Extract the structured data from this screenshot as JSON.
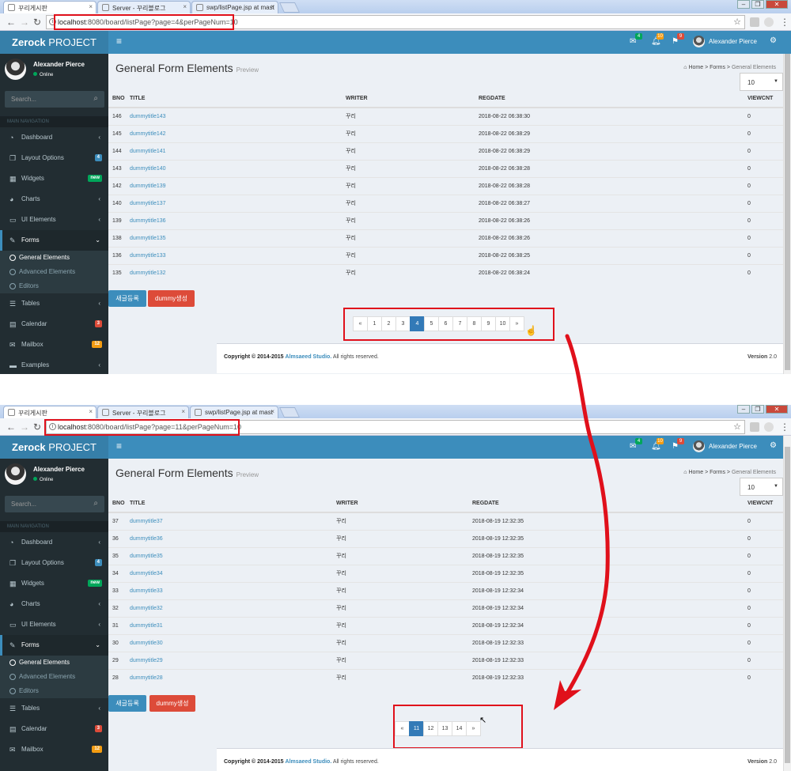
{
  "shots": [
    {
      "tabs": [
        "꾸리게시판",
        "Server - 꾸리블로그",
        "swp/listPage.jsp at mast"
      ],
      "url_host": "localhost",
      "url_rest": ":8080/board/listPage?page=4&perPageNum=10",
      "rows": [
        {
          "bno": "146",
          "title": "dummytitle143",
          "writer": "꾸리",
          "regdate": "2018-08-22 06:38:30",
          "viewcnt": "0"
        },
        {
          "bno": "145",
          "title": "dummytitle142",
          "writer": "꾸리",
          "regdate": "2018-08-22 06:38:29",
          "viewcnt": "0"
        },
        {
          "bno": "144",
          "title": "dummytitle141",
          "writer": "꾸리",
          "regdate": "2018-08-22 06:38:29",
          "viewcnt": "0"
        },
        {
          "bno": "143",
          "title": "dummytitle140",
          "writer": "꾸리",
          "regdate": "2018-08-22 06:38:28",
          "viewcnt": "0"
        },
        {
          "bno": "142",
          "title": "dummytitle139",
          "writer": "꾸리",
          "regdate": "2018-08-22 06:38:28",
          "viewcnt": "0"
        },
        {
          "bno": "140",
          "title": "dummytitle137",
          "writer": "꾸리",
          "regdate": "2018-08-22 06:38:27",
          "viewcnt": "0"
        },
        {
          "bno": "139",
          "title": "dummytitle136",
          "writer": "꾸리",
          "regdate": "2018-08-22 06:38:26",
          "viewcnt": "0"
        },
        {
          "bno": "138",
          "title": "dummytitle135",
          "writer": "꾸리",
          "regdate": "2018-08-22 06:38:26",
          "viewcnt": "0"
        },
        {
          "bno": "136",
          "title": "dummytitle133",
          "writer": "꾸리",
          "regdate": "2018-08-22 06:38:25",
          "viewcnt": "0"
        },
        {
          "bno": "135",
          "title": "dummytitle132",
          "writer": "꾸리",
          "regdate": "2018-08-22 06:38:24",
          "viewcnt": "0"
        }
      ],
      "pages": [
        "«",
        "1",
        "2",
        "3",
        "4",
        "5",
        "6",
        "7",
        "8",
        "9",
        "10",
        "»"
      ],
      "active_page": "4"
    },
    {
      "tabs": [
        "꾸리게시판",
        "Server - 꾸리블로그",
        "swp/listPage.jsp at mast"
      ],
      "url_host": "localhost",
      "url_rest": ":8080/board/listPage?page=11&perPageNum=10",
      "rows": [
        {
          "bno": "37",
          "title": "dummytitle37",
          "writer": "꾸리",
          "regdate": "2018-08-19 12:32:35",
          "viewcnt": "0"
        },
        {
          "bno": "36",
          "title": "dummytitle36",
          "writer": "꾸리",
          "regdate": "2018-08-19 12:32:35",
          "viewcnt": "0"
        },
        {
          "bno": "35",
          "title": "dummytitle35",
          "writer": "꾸리",
          "regdate": "2018-08-19 12:32:35",
          "viewcnt": "0"
        },
        {
          "bno": "34",
          "title": "dummytitle34",
          "writer": "꾸리",
          "regdate": "2018-08-19 12:32:35",
          "viewcnt": "0"
        },
        {
          "bno": "33",
          "title": "dummytitle33",
          "writer": "꾸리",
          "regdate": "2018-08-19 12:32:34",
          "viewcnt": "0"
        },
        {
          "bno": "32",
          "title": "dummytitle32",
          "writer": "꾸리",
          "regdate": "2018-08-19 12:32:34",
          "viewcnt": "0"
        },
        {
          "bno": "31",
          "title": "dummytitle31",
          "writer": "꾸리",
          "regdate": "2018-08-19 12:32:34",
          "viewcnt": "0"
        },
        {
          "bno": "30",
          "title": "dummytitle30",
          "writer": "꾸리",
          "regdate": "2018-08-19 12:32:33",
          "viewcnt": "0"
        },
        {
          "bno": "29",
          "title": "dummytitle29",
          "writer": "꾸리",
          "regdate": "2018-08-19 12:32:33",
          "viewcnt": "0"
        },
        {
          "bno": "28",
          "title": "dummytitle28",
          "writer": "꾸리",
          "regdate": "2018-08-19 12:32:33",
          "viewcnt": "0"
        }
      ],
      "pages": [
        "«",
        "11",
        "12",
        "13",
        "14",
        "»"
      ],
      "active_page": "11"
    }
  ],
  "app": {
    "brand_bold": "Zerock",
    "brand_light": " PROJECT",
    "user_name": "Alexander Pierce",
    "user_status": "Online",
    "search_placeholder": "Search...",
    "nav_header": "MAIN NAVIGATION",
    "notif_badges": [
      "4",
      "10",
      "9"
    ],
    "notif_colors": [
      "#00a65a",
      "#f39c12",
      "#dd4b39"
    ],
    "menu": [
      {
        "icon": "dashboard-icon",
        "label": "Dashboard"
      },
      {
        "icon": "files-icon",
        "label": "Layout Options",
        "badge": "4",
        "badge_color": "#3c8dbc"
      },
      {
        "icon": "th-icon",
        "label": "Widgets",
        "badge": "new",
        "badge_color": "#00a65a"
      },
      {
        "icon": "pie-chart-icon",
        "label": "Charts"
      },
      {
        "icon": "laptop-icon",
        "label": "UI Elements"
      },
      {
        "icon": "edit-icon",
        "label": "Forms"
      }
    ],
    "forms_sub": [
      "General Elements",
      "Advanced Elements",
      "Editors"
    ],
    "menu_after": [
      {
        "icon": "table-icon",
        "label": "Tables"
      },
      {
        "icon": "calendar-icon",
        "label": "Calendar",
        "badge": "3",
        "badge_color": "#dd4b39"
      },
      {
        "icon": "envelope-icon",
        "label": "Mailbox",
        "badge": "12",
        "badge_color": "#f39c12"
      },
      {
        "icon": "folder-icon",
        "label": "Examples"
      }
    ],
    "page_title": "General Form Elements",
    "page_subtitle": "Preview",
    "breadcrumb": [
      "Home",
      "Forms",
      "General Elements"
    ],
    "per_page_value": "10",
    "columns": [
      "BNO",
      "TITLE",
      "WRITER",
      "REGDATE",
      "VIEWCNT"
    ],
    "register_button": "새글등록",
    "dummy_button": "dummy생성",
    "footer_copyright": "Copyright © 2014-2015",
    "footer_company": "Almsaeed Studio.",
    "footer_rights": " All rights reserved.",
    "footer_version_label": "Version",
    "footer_version": " 2.0"
  }
}
